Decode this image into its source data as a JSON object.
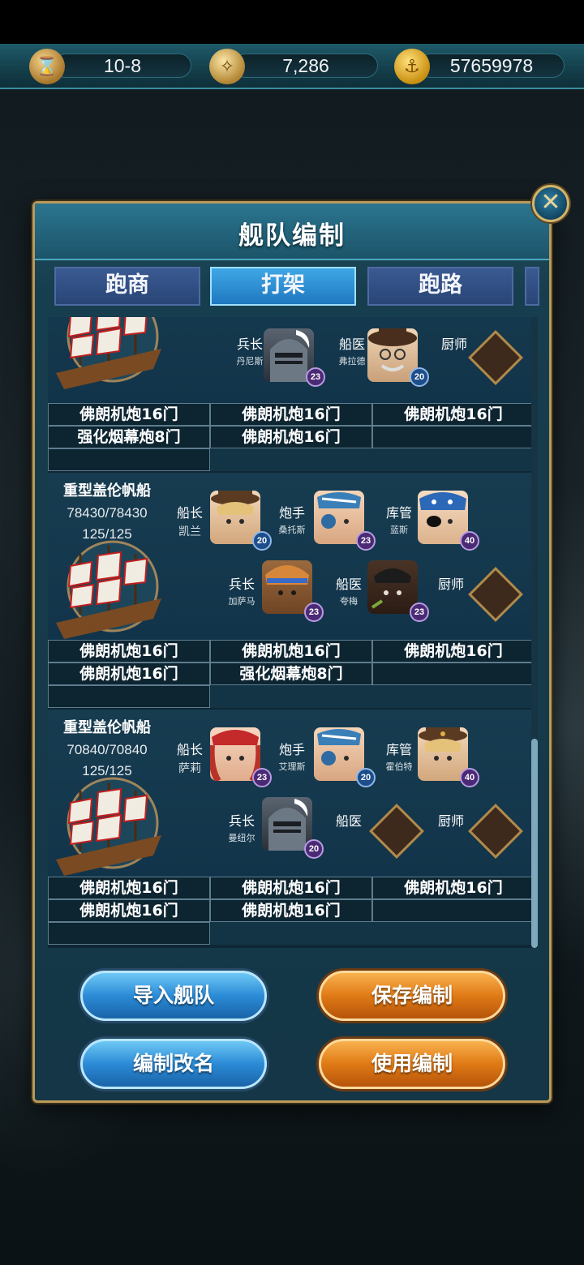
{
  "resources": {
    "stage": "10-8",
    "compass_value": "7,286",
    "gold_value": "57659978"
  },
  "dialog": {
    "title": "舰队编制",
    "tabs": [
      {
        "label": "跑商",
        "active": false
      },
      {
        "label": "打架",
        "active": true
      },
      {
        "label": "跑路",
        "active": false
      }
    ]
  },
  "ships": [
    {
      "crew": [
        {
          "role": "兵长",
          "name": "丹尼斯",
          "level": "23"
        },
        {
          "role": "船医",
          "name": "弗拉德",
          "level": "20"
        },
        {
          "role": "厨师",
          "name": "",
          "level": ""
        }
      ],
      "weapons": [
        "佛朗机炮16门",
        "佛朗机炮16门",
        "佛朗机炮16门",
        "强化烟幕炮8门",
        "佛朗机炮16门",
        "",
        "",
        "",
        ""
      ]
    },
    {
      "name": "重型盖伦帆船",
      "hp": "78430/78430",
      "crew_count": "125/125",
      "crew": [
        {
          "role": "船长",
          "name": "凯兰",
          "level": "20"
        },
        {
          "role": "炮手",
          "name": "桑托斯",
          "level": "23"
        },
        {
          "role": "库管",
          "name": "蓝斯",
          "level": "40"
        },
        {
          "role": "兵长",
          "name": "加萨马",
          "level": "23"
        },
        {
          "role": "船医",
          "name": "夸梅",
          "level": "23"
        },
        {
          "role": "厨师",
          "name": "",
          "level": ""
        }
      ],
      "weapons": [
        "佛朗机炮16门",
        "佛朗机炮16门",
        "佛朗机炮16门",
        "佛朗机炮16门",
        "强化烟幕炮8门",
        "",
        "",
        "",
        ""
      ]
    },
    {
      "name": "重型盖伦帆船",
      "hp": "70840/70840",
      "crew_count": "125/125",
      "crew": [
        {
          "role": "船长",
          "name": "萨莉",
          "level": "23"
        },
        {
          "role": "炮手",
          "name": "艾理斯",
          "level": "20"
        },
        {
          "role": "库管",
          "name": "霍伯特",
          "level": "40"
        },
        {
          "role": "兵长",
          "name": "曼纽尔",
          "level": "20"
        },
        {
          "role": "船医",
          "name": "",
          "level": ""
        },
        {
          "role": "厨师",
          "name": "",
          "level": ""
        }
      ],
      "weapons": [
        "佛朗机炮16门",
        "佛朗机炮16门",
        "佛朗机炮16门",
        "佛朗机炮16门",
        "佛朗机炮16门",
        "",
        "",
        "",
        ""
      ]
    }
  ],
  "buttons": {
    "import": "导入舰队",
    "save": "保存编制",
    "rename": "编制改名",
    "use": "使用编制"
  },
  "colors": {
    "tab_active": "#2b8fd2",
    "tab_inactive": "#2f4d82",
    "button_blue": "#2b8bd6",
    "button_orange": "#e07a16",
    "frame_gold": "#b99a5a"
  }
}
